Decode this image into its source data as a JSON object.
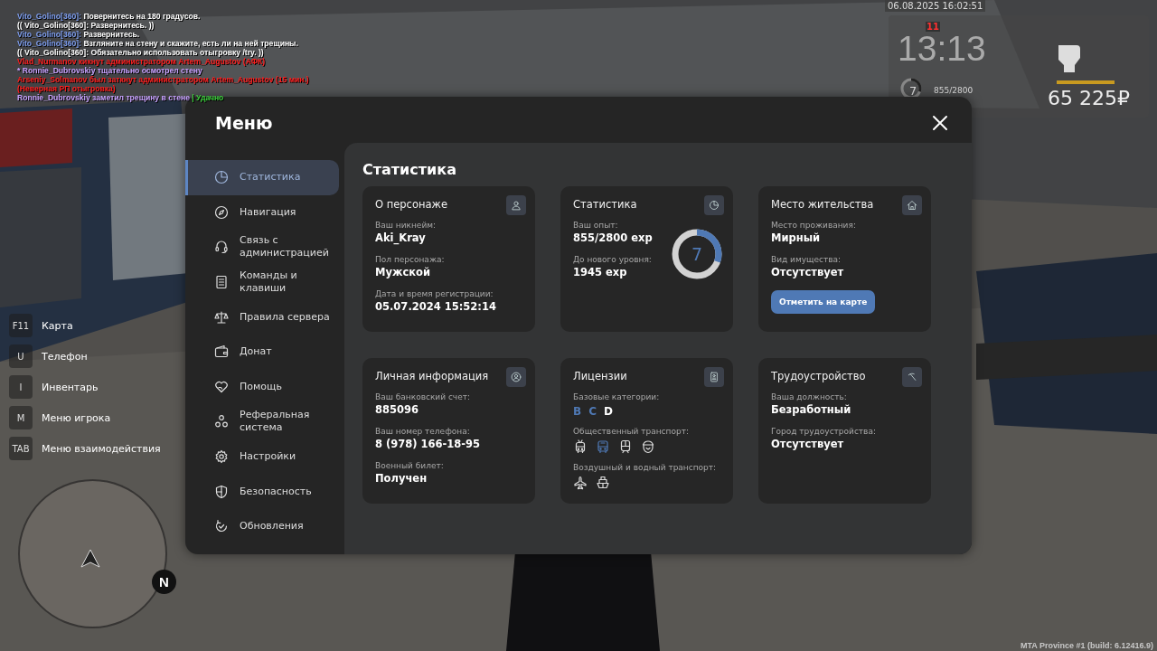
{
  "chat": [
    {
      "parts": [
        {
          "text": "Vito_Golino[360]:",
          "color": "#7f9ff0"
        },
        {
          "text": " Повернитесь на 180 градусов.",
          "color": "#ffffff"
        }
      ]
    },
    {
      "parts": [
        {
          "text": "(( Vito_Golino[360]: Развернитесь. ))",
          "color": "#ffffff"
        }
      ]
    },
    {
      "parts": [
        {
          "text": "Vito_Golino[360]:",
          "color": "#7f9ff0"
        },
        {
          "text": " Развернитесь.",
          "color": "#ffffff"
        }
      ]
    },
    {
      "parts": [
        {
          "text": "Vito_Golino[360]:",
          "color": "#7f9ff0"
        },
        {
          "text": " Взгляните на стену и скажите, есть ли на ней трещины.",
          "color": "#ffffff"
        }
      ]
    },
    {
      "parts": [
        {
          "text": "(( Vito_Golino[360]: Обязательно использовать отыгровку /try. ))",
          "color": "#ffffff"
        }
      ]
    },
    {
      "parts": [
        {
          "text": "Vlad_Nurmanov кикнут администратором Artem_Augustov (АФК)",
          "color": "#ff1e1e"
        }
      ]
    },
    {
      "parts": [
        {
          "text": "* Ronnie_Dubrovskiy тщательно осмотрел стену",
          "color": "#c8a2ff"
        }
      ]
    },
    {
      "parts": [
        {
          "text": "Arseniy_Solmanov был заткнут администратором Artem_Augustov (15 мин.)",
          "color": "#ff1e1e"
        }
      ]
    },
    {
      "parts": [
        {
          "text": "(Неверная РП отыгровка)",
          "color": "#ff1e1e"
        }
      ]
    },
    {
      "parts": [
        {
          "text": "Ronnie_Dubrovskiy заметил трещину в стене ",
          "color": "#c8a2ff"
        },
        {
          "text": "| Удачно",
          "color": "#3ccf3c"
        }
      ]
    }
  ],
  "hud": {
    "date": "06.08.2025 16:02:51",
    "wanted": "11",
    "time": "13:13",
    "level_number": "7",
    "xp": "855/2800",
    "money": "65 225₽",
    "ring": {
      "level": 0.3
    },
    "meter": {
      "level": 1
    }
  },
  "keybinds": [
    {
      "key": "F11",
      "label": "Карта"
    },
    {
      "key": "U",
      "label": "Телефон"
    },
    {
      "key": "I",
      "label": "Инвентарь"
    },
    {
      "key": "M",
      "label": "Меню игрока"
    },
    {
      "key": "TAB",
      "label": "Меню взаимодействия"
    }
  ],
  "minimap": {
    "compass": "N"
  },
  "version": "MTA Province #1 (build: 6.12416.9)",
  "menu": {
    "title": "Меню",
    "sidebar": [
      {
        "label": "Статистика",
        "selected": true
      },
      {
        "label": "Навигация",
        "selected": false
      },
      {
        "label": "Связь с администрацией",
        "selected": false
      },
      {
        "label": "Команды и клавиши",
        "selected": false
      },
      {
        "label": "Правила сервера",
        "selected": false
      },
      {
        "label": "Донат",
        "selected": false
      },
      {
        "label": "Помощь",
        "selected": false
      },
      {
        "label": "Реферальная система",
        "selected": false
      },
      {
        "label": "Настройки",
        "selected": false
      },
      {
        "label": "Безопасность",
        "selected": false
      },
      {
        "label": "Обновления",
        "selected": false
      }
    ],
    "section_title": "Статистика",
    "cards": [
      {
        "kind": "fields",
        "title": "О персонаже",
        "fields": [
          {
            "label": "Ваш никнейм:",
            "value": "Aki_Kray"
          },
          {
            "label": "Пол персонажа:",
            "value": "Мужской"
          },
          {
            "label": "Дата и время регистрации:",
            "value": "05.07.2024 15:52:14"
          }
        ]
      },
      {
        "kind": "level",
        "title": "Статистика",
        "fields": [
          {
            "label": "Ваш опыт:",
            "value": "855/2800 exp"
          },
          {
            "label": "До нового уровня:",
            "value": "1945 exp"
          }
        ],
        "donut": {
          "value": "7",
          "level": 0.305
        }
      },
      {
        "kind": "button",
        "title": "Место жительства",
        "fields": [
          {
            "label": "Место проживания:",
            "value": "Мирный"
          },
          {
            "label": "Вид имущества:",
            "value": "Отсутствует"
          }
        ],
        "button": "Отметить на карте"
      },
      {
        "kind": "fields",
        "title": "Личная информация",
        "fields": [
          {
            "label": "Ваш банковский счет:",
            "value": "885096"
          },
          {
            "label": "Ваш номер телефона:",
            "value": "8 (978) 166-18-95"
          },
          {
            "label": "Военный билет:",
            "value": "Получен"
          }
        ]
      },
      {
        "kind": "licenses",
        "title": "Лицензии",
        "groups": [
          {
            "kind": "letters",
            "label": "Базовые категории:",
            "items": [
              {
                "text": "B",
                "active": true
              },
              {
                "text": "C",
                "active": true
              },
              {
                "text": "D",
                "active": false
              }
            ]
          },
          {
            "kind": "icons",
            "label": "Общественный транспорт:",
            "items": [
              {
                "kind": "trolleybus",
                "active": false
              },
              {
                "kind": "bus",
                "active": true
              },
              {
                "kind": "train",
                "active": false
              },
              {
                "kind": "cap",
                "active": false
              }
            ]
          },
          {
            "kind": "icons",
            "label": "Воздушный и водный транспорт:",
            "items": [
              {
                "kind": "plane",
                "active": false
              },
              {
                "kind": "ship",
                "active": false
              }
            ]
          }
        ]
      },
      {
        "kind": "fields",
        "title": "Трудоустройство",
        "fields": [
          {
            "label": "Ваша должность:",
            "value": "Безработный"
          },
          {
            "label": "Город трудоустройства:",
            "value": "Отсутствует"
          }
        ]
      }
    ]
  }
}
